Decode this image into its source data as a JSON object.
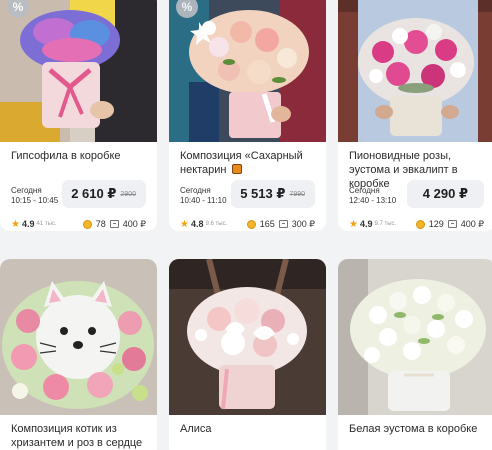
{
  "colors": {
    "page_bg": "#f2f3f5",
    "card_bg": "#ffffff",
    "price_box": "#eef0f3",
    "star": "#f2a20c",
    "coin": "#f3b52a"
  },
  "products_row1": [
    {
      "title": "Гипсофила в коробке",
      "has_badge": true,
      "badge": "%",
      "delivery_day": "Сегодня",
      "delivery_time": "10:15 - 10:45",
      "price": "2 610 ₽",
      "old_price": "2900",
      "rating": "4.9",
      "reviews": "41 тыс.",
      "bonus": "78",
      "weight": "400 ₽"
    },
    {
      "title": "Композиция «Сахарный нектарин",
      "title_icon": "orange-heart-icon",
      "has_badge": true,
      "badge": "%",
      "delivery_day": "Сегодня",
      "delivery_time": "10:40 - 11:10",
      "price": "5 513 ₽",
      "old_price": "7990",
      "rating": "4.8",
      "reviews": "9.6 тыс.",
      "bonus": "165",
      "weight": "300 ₽"
    },
    {
      "title": "Пионовидные розы, эустома и эвкалипт в коробке",
      "has_badge": false,
      "delivery_day": "Сегодня",
      "delivery_time": "12:40 - 13:10",
      "price": "4 290 ₽",
      "old_price": "",
      "rating": "4.9",
      "reviews": "9.7 тыс.",
      "bonus": "129",
      "weight": "400 ₽"
    }
  ],
  "products_row2": [
    {
      "title": "Композиция котик из хризантем и роз в сердце"
    },
    {
      "title": "Алиса"
    },
    {
      "title": "Белая эустома в коробке"
    }
  ]
}
